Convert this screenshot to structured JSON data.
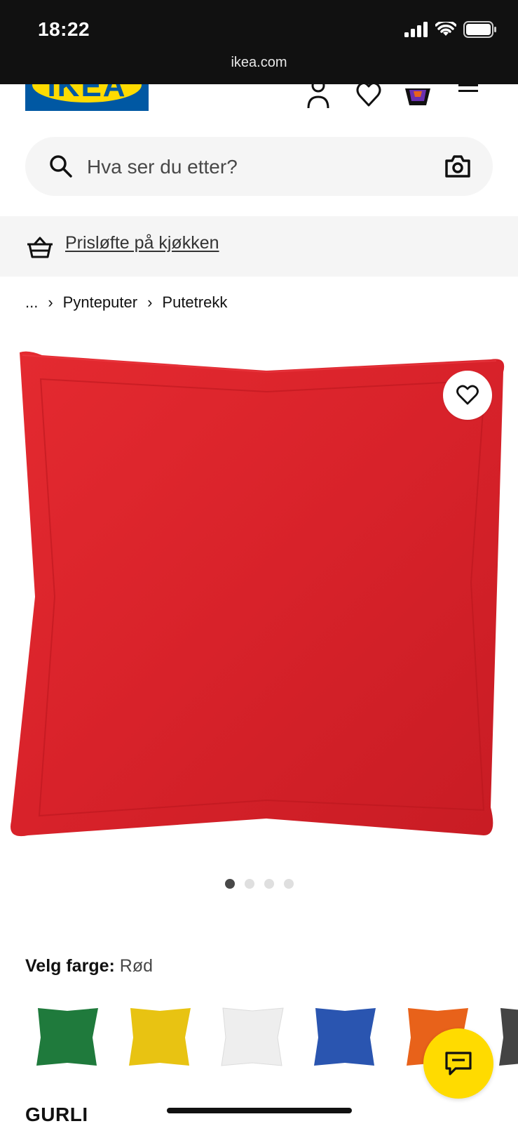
{
  "status_bar": {
    "time": "18:22",
    "url": "ikea.com",
    "icons": [
      "signal-icon",
      "wifi-icon",
      "battery-icon"
    ]
  },
  "header": {
    "logo_text": "IKEA",
    "icons": [
      "account-icon",
      "heart-icon",
      "basket-icon",
      "menu-icon"
    ]
  },
  "search": {
    "placeholder": "Hva ser du etter?",
    "icons": [
      "search-icon",
      "camera-icon"
    ]
  },
  "promo": {
    "label": "Prisløfte på kjøkken",
    "icon": "basket-icon"
  },
  "breadcrumb": {
    "items": [
      "...",
      "Pynteputer",
      "Putetrekk"
    ],
    "separator": "›"
  },
  "product": {
    "image_color": "#d8222a",
    "favorite_icon": "heart-icon",
    "gallery": {
      "count": 4,
      "active_index": 0
    },
    "color_label": "Velg farge:",
    "selected_color": "Rød",
    "swatches": [
      {
        "color": "#1f7a3c"
      },
      {
        "color": "#e8c312"
      },
      {
        "color": "#eeeeee"
      },
      {
        "color": "#2a55b0"
      },
      {
        "color": "#e8621a"
      },
      {
        "color": "#444444"
      }
    ],
    "name": "GURLI"
  },
  "chat": {
    "icon": "chat-icon"
  },
  "colors": {
    "ikea_blue": "#0058a3",
    "ikea_yellow": "#ffdb00"
  }
}
